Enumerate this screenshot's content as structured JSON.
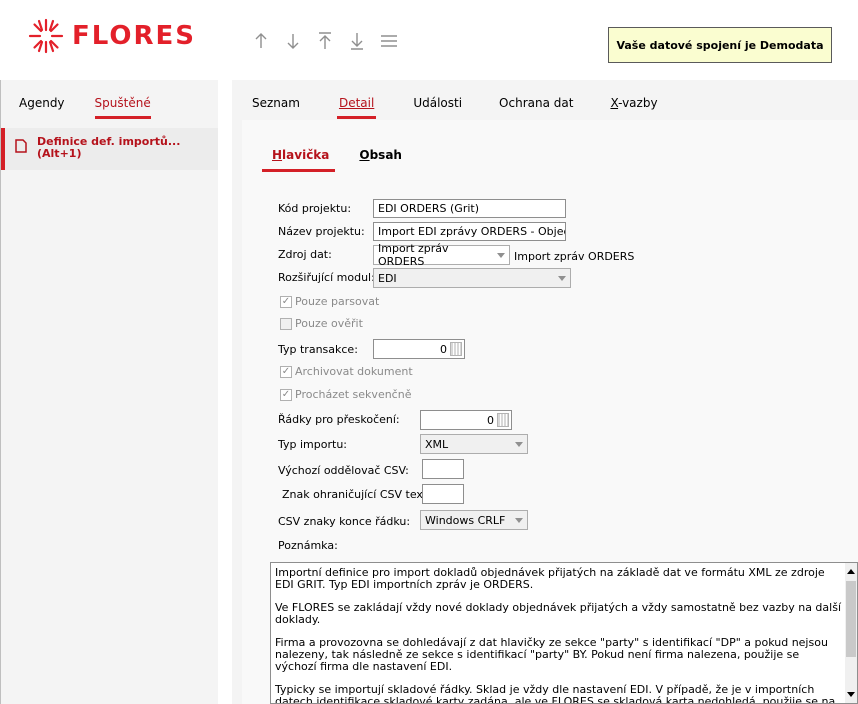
{
  "brand": {
    "name": "FLORES",
    "color": "#e3202a"
  },
  "toolbar": {
    "icons": [
      "arrow-up-icon",
      "arrow-down-icon",
      "move-top-icon",
      "move-bottom-icon",
      "menu-icon"
    ]
  },
  "connection": {
    "text": "Vaše datové spojení je Demodata"
  },
  "left": {
    "tabs": [
      {
        "label": "Agendy",
        "active": false
      },
      {
        "label": "Spuštěné",
        "active": true
      }
    ],
    "item": {
      "line1": "Definice def. importů...",
      "line2": "(Alt+1)"
    }
  },
  "main": {
    "tabs": [
      {
        "label": "Seznam"
      },
      {
        "label": "Detail",
        "active": true
      },
      {
        "label": "Události"
      },
      {
        "label": "Ochrana dat"
      },
      {
        "label": "X-vazby"
      }
    ],
    "subtabs": [
      {
        "label": "Hlavička",
        "active": true
      },
      {
        "label": "Obsah"
      }
    ]
  },
  "form": {
    "kod_label": "Kód projektu:",
    "kod_value": "EDI ORDERS (Grit)",
    "nazev_label": "Název projektu:",
    "nazev_value": "Import EDI zprávy ORDERS - Objednáv",
    "zdroj_label": "Zdroj dat:",
    "zdroj_value": "Import zpráv ORDERS",
    "zdroj_desc": "Import zpráv ORDERS",
    "modul_label": "Rozšiřující modul:",
    "modul_value": "EDI",
    "pouze_parsovat": "Pouze parsovat",
    "pouze_parsovat_checked": true,
    "pouze_overit": "Pouze ověřit",
    "pouze_overit_checked": false,
    "typ_transakce_label": "Typ transakce:",
    "typ_transakce_value": "0",
    "archivovat": "Archivovat dokument",
    "archivovat_checked": true,
    "prochazet": "Procházet sekvenčně",
    "prochazet_checked": true,
    "radky_label": "Řádky pro přeskočení:",
    "radky_value": "0",
    "typ_importu_label": "Typ importu:",
    "typ_importu_value": "XML",
    "oddelovac_label": "Výchozí oddělovač CSV:",
    "znak_label": "Znak ohraničující CSV text:",
    "csv_konce_label": "CSV znaky konce řádku:",
    "csv_konce_value": "Windows CRLF",
    "poznamka_label": "Poznámka:"
  },
  "note": {
    "paragraphs": [
      "Importní definice pro import dokladů objednávek přijatých na základě dat ve formátu XML ze zdroje EDI GRIT. Typ EDI importních zpráv je ORDERS.",
      "Ve FLORES se zakládají vždy nové doklady objednávek přijatých a vždy samostatně bez vazby na další doklady.",
      "Firma a provozovna se dohledávají z dat hlavičky ze sekce \"party\" s identifikací \"DP\" a pokud nejsou nalezeny, tak následně ze sekce s identifikací \"party\" BY. Pokud není firma nalezena, použije se výchozí firma dle nastavení EDI.",
      "Typicky se importují skladové řádky. Sklad je vždy dle nastavení EDI. V případě, že je v importních datech identifikace skladové karty zadána, ale ve FLORES se skladová karta nedohledá, použije se na řádku výchozí skladová karta dle nastavení EDI a do textu řádku se zapíše textový název skladové karty dle importních dat EDI."
    ]
  }
}
